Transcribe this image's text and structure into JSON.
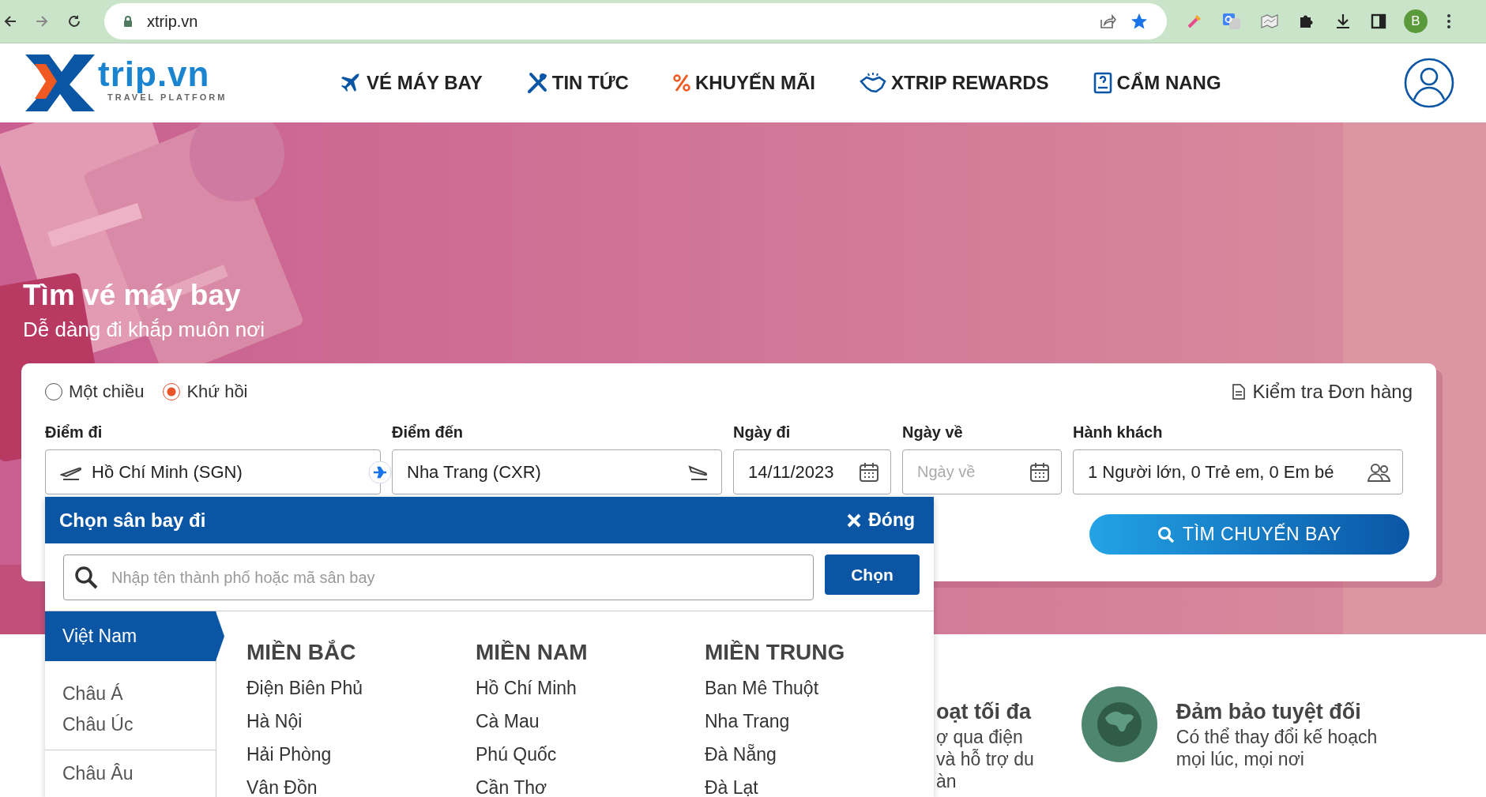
{
  "browser": {
    "url": "xtrip.vn",
    "profile_initial": "B"
  },
  "logo": {
    "name": "trip.vn",
    "tagline": "TRAVEL PLATFORM"
  },
  "nav": [
    {
      "label": "VÉ MÁY BAY"
    },
    {
      "label": "TIN TỨC"
    },
    {
      "label": "KHUYẾN MÃI"
    },
    {
      "label": "XTRIP REWARDS"
    },
    {
      "label": "CẨM NANG"
    }
  ],
  "hero": {
    "title": "Tìm vé máy bay",
    "subtitle": "Dễ dàng đi khắp muôn nơi"
  },
  "search": {
    "trip_types": [
      {
        "label": "Một chiều",
        "selected": false
      },
      {
        "label": "Khứ hồi",
        "selected": true
      }
    ],
    "check_order": "Kiểm tra Đơn hàng",
    "fields": [
      {
        "kind": "origin",
        "label": "Điểm đi",
        "value": "Hồ Chí Minh (SGN)"
      },
      {
        "kind": "destination",
        "label": "Điểm đến",
        "value": "Nha Trang (CXR)"
      },
      {
        "kind": "date",
        "label": "Ngày đi",
        "value": "14/11/2023"
      },
      {
        "kind": "date",
        "label": "Ngày về",
        "placeholder": "Ngày về"
      },
      {
        "kind": "passengers",
        "label": "Hành khách",
        "value": "1 Người lớn, 0 Trẻ em, 0 Em bé"
      }
    ],
    "search_button": "TÌM CHUYẾN BAY"
  },
  "airport_picker": {
    "title": "Chọn sân bay đi",
    "close": "Đóng",
    "search_placeholder": "Nhập tên thành phố hoặc mã sân bay",
    "choose_button": "Chọn",
    "regions": [
      {
        "label": "Việt Nam",
        "selected": true,
        "separated": false
      },
      {
        "label": "Châu Á",
        "selected": false,
        "separated": false
      },
      {
        "label": "Châu Úc",
        "selected": false,
        "separated": false
      },
      {
        "label": "Châu Âu",
        "selected": false,
        "separated": true
      }
    ],
    "columns": [
      {
        "heading": "MIỀN BẮC",
        "airports": [
          "Điện Biên Phủ",
          "Hà Nội",
          "Hải Phòng",
          "Vân Đồn"
        ]
      },
      {
        "heading": "MIỀN NAM",
        "airports": [
          "Hồ Chí Minh",
          "Cà Mau",
          "Phú Quốc",
          "Cần Thơ"
        ]
      },
      {
        "heading": "MIỀN TRUNG",
        "airports": [
          "Ban Mê Thuột",
          "Nha Trang",
          "Đà Nẵng",
          "Đà Lạt"
        ]
      }
    ]
  },
  "features": [
    {
      "icon": false,
      "title": "oạt tối đa",
      "lines": [
        "ợ qua điện",
        "và hỗ trợ du",
        "àn"
      ]
    },
    {
      "icon": true,
      "title": "Đảm bảo tuyệt đối",
      "lines": [
        "Có thể thay đổi kế hoạch",
        "mọi lúc, mọi nơi"
      ]
    }
  ]
}
